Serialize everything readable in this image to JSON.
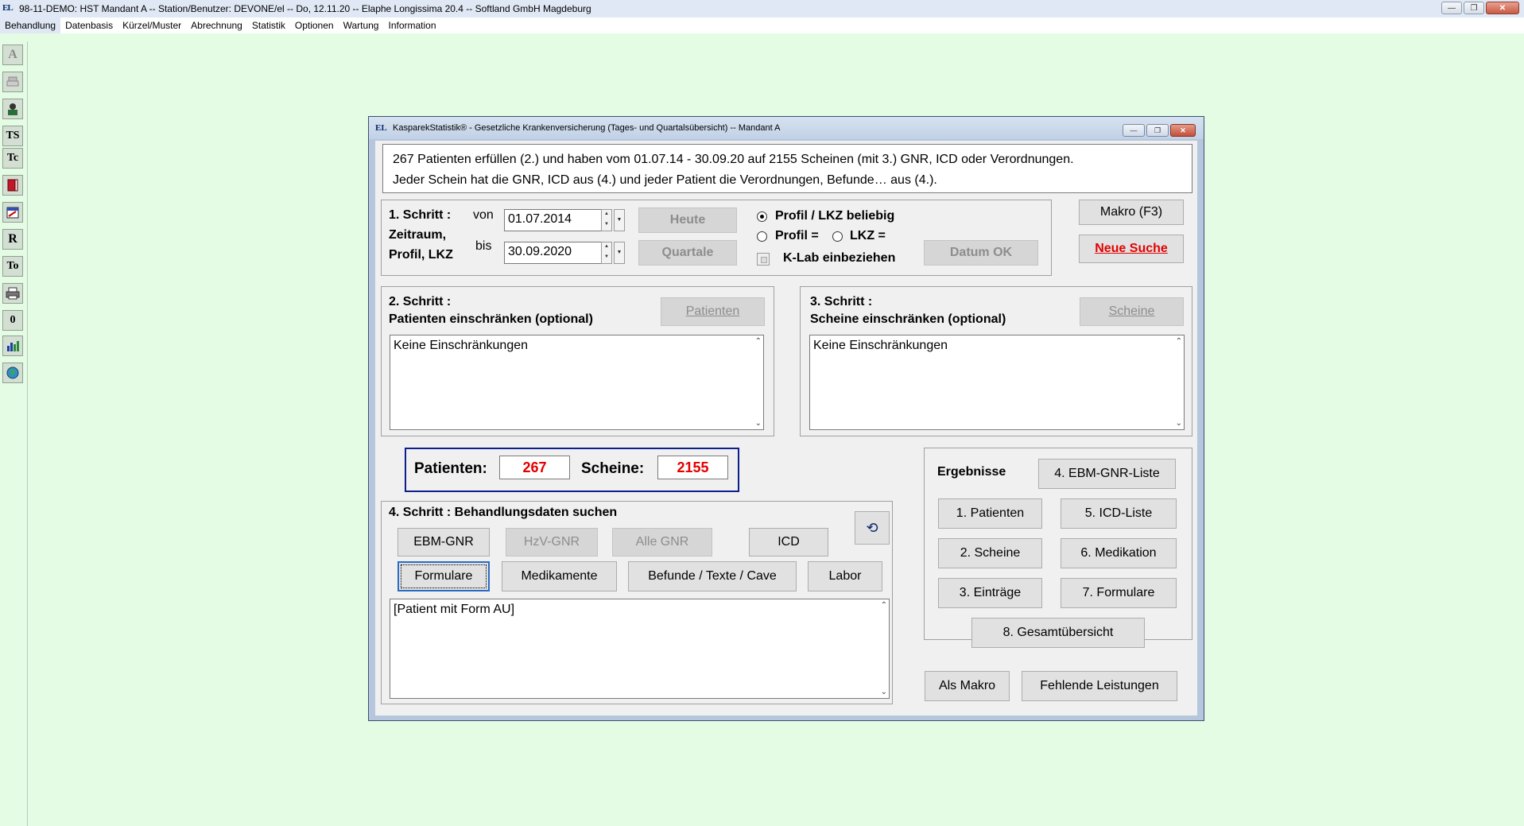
{
  "app": {
    "title": "98-11-DEMO: HST Mandant A -- Station/Benutzer: DEVONE/el -- Do, 12.11.20 -- Elaphe Longissima 20.4 -- Softland GmbH Magdeburg",
    "icon_text": "EL"
  },
  "menu": [
    "Behandlung",
    "Datenbasis",
    "Kürzel/Muster",
    "Abrechnung",
    "Statistik",
    "Optionen",
    "Wartung",
    "Information"
  ],
  "toolbar": {
    "items": [
      "A",
      "TS",
      "Tc",
      "R",
      "To",
      "0"
    ]
  },
  "dialog": {
    "title": "KasparekStatistik® - Gesetzliche Krankenversicherung (Tages- und Quartalsübersicht) -- Mandant A",
    "info_line1": "267 Patienten erfüllen (2.) und haben vom 01.07.14 - 30.09.20 auf 2155 Scheinen (mit 3.) GNR, ICD oder Verordnungen.",
    "info_line2": "Jeder Schein hat die GNR, ICD aus (4.) und jeder Patient die Verordnungen, Befunde… aus (4.).",
    "step1": {
      "title": "1. Schritt :",
      "line2": "Zeitraum,",
      "line3": "Profil, LKZ",
      "von_label": "von",
      "bis_label": "bis",
      "von_value": "01.07.2014",
      "bis_value": "30.09.2020",
      "heute": "Heute",
      "quartale": "Quartale",
      "profil_beliebig": "Profil / LKZ beliebig",
      "profil_eq": "Profil =",
      "lkz_eq": "LKZ =",
      "klab": "K-Lab einbeziehen",
      "datum_ok": "Datum OK"
    },
    "makro": "Makro (F3)",
    "neue_suche": "Neue Suche",
    "step2": {
      "title": "2. Schritt :",
      "subtitle": "Patienten einschränken (optional)",
      "button": "Patienten",
      "text": "Keine Einschränkungen"
    },
    "step3": {
      "title": "3. Schritt :",
      "subtitle": "Scheine einschränken (optional)",
      "button": "Scheine",
      "text": "Keine Einschränkungen"
    },
    "counts": {
      "patienten_label": "Patienten:",
      "patienten_value": "267",
      "scheine_label": "Scheine:",
      "scheine_value": "2155"
    },
    "step4": {
      "title": "4. Schritt : Behandlungsdaten suchen",
      "buttons_row1": [
        "EBM-GNR",
        "HzV-GNR",
        "Alle GNR",
        "ICD"
      ],
      "buttons_row2": [
        "Formulare",
        "Medikamente",
        "Befunde / Texte / Cave",
        "Labor"
      ],
      "text": "[Patient mit Form AU]"
    },
    "ergebnisse": {
      "title": "Ergebnisse",
      "ebm_liste": "4. EBM-GNR-Liste",
      "patienten": "1. Patienten",
      "icd_liste": "5. ICD-Liste",
      "scheine": "2. Scheine",
      "medikation": "6. Medikation",
      "eintraege": "3. Einträge",
      "formulare": "7. Formulare",
      "gesamt": "8. Gesamtübersicht"
    },
    "als_makro": "Als Makro",
    "fehlende": "Fehlende Leistungen"
  }
}
